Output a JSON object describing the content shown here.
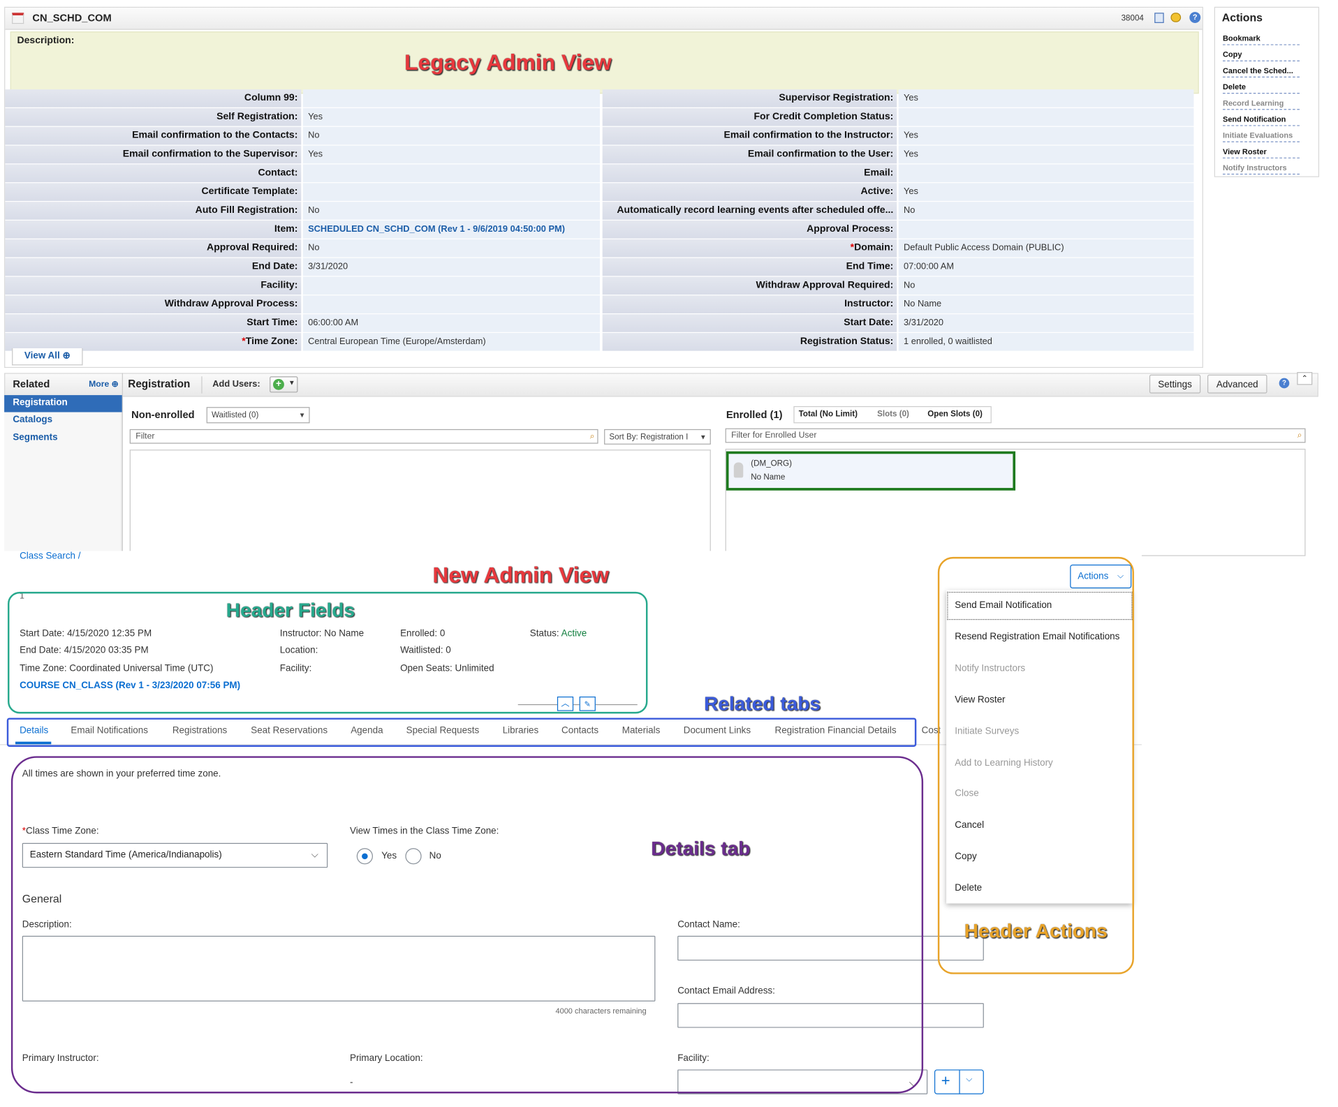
{
  "legacy": {
    "title": "CN_SCHD_COM",
    "record_id": "38004",
    "description_label": "Description:",
    "rows_left": [
      {
        "label": "Column 99:",
        "value": ""
      },
      {
        "label": "Self Registration:",
        "value": "Yes"
      },
      {
        "label": "Email confirmation to the Contacts:",
        "value": "No"
      },
      {
        "label": "Email confirmation to the Supervisor:",
        "value": "Yes"
      },
      {
        "label": "Contact:",
        "value": ""
      },
      {
        "label": "Certificate Template:",
        "value": ""
      },
      {
        "label": "Auto Fill Registration:",
        "value": "No"
      },
      {
        "label": "Item:",
        "value": "SCHEDULED CN_SCHD_COM (Rev 1 - 9/6/2019 04:50:00 PM)"
      },
      {
        "label": "Approval Required:",
        "value": "No"
      },
      {
        "label": "End Date:",
        "value": "3/31/2020"
      },
      {
        "label": "Facility:",
        "value": ""
      },
      {
        "label": "Withdraw Approval Process:",
        "value": ""
      },
      {
        "label": "Start Time:",
        "value": "06:00:00 AM"
      },
      {
        "label": "Time Zone:",
        "value": "Central European Time (Europe/Amsterdam)"
      }
    ],
    "rows_right": [
      {
        "label": "Supervisor Registration:",
        "value": "Yes"
      },
      {
        "label": "For Credit Completion Status:",
        "value": ""
      },
      {
        "label": "Email confirmation to the Instructor:",
        "value": "Yes"
      },
      {
        "label": "Email confirmation to the User:",
        "value": "Yes"
      },
      {
        "label": "Email:",
        "value": ""
      },
      {
        "label": "Active:",
        "value": "Yes"
      },
      {
        "label": "Automatically record learning events after scheduled offe...",
        "value": "No"
      },
      {
        "label": "Approval Process:",
        "value": ""
      },
      {
        "label": "Domain:",
        "value": "Default Public Access Domain (PUBLIC)"
      },
      {
        "label": "End Time:",
        "value": "07:00:00 AM"
      },
      {
        "label": "Withdraw Approval Required:",
        "value": "No"
      },
      {
        "label": "Instructor:",
        "value": "No Name"
      },
      {
        "label": "Start Date:",
        "value": "3/31/2020"
      },
      {
        "label": "Registration Status:",
        "value": "1 enrolled, 0 waitlisted"
      }
    ],
    "view_all": "View All",
    "actions": {
      "title": "Actions",
      "items": [
        "Bookmark",
        "Copy",
        "Cancel the Sched...",
        "Delete",
        "Record Learning",
        "Send Notification",
        "Initiate Evaluations",
        "View Roster",
        "Notify Instructors"
      ]
    },
    "related": {
      "title": "Related",
      "more": "More",
      "items": [
        "Registration",
        "Catalogs",
        "Segments"
      ],
      "section_title": "Registration",
      "add_users": "Add Users:",
      "settings": "Settings",
      "advanced": "Advanced",
      "non_enrolled": "Non-enrolled",
      "waitlisted_select": "Waitlisted (0)",
      "filter_placeholder": "Filter",
      "sort_by": "Sort By: Registration I",
      "enrolled": "Enrolled (1)",
      "total": "Total (No Limit)",
      "slots": "Slots (0)",
      "open_slots": "Open Slots (0)",
      "enrolled_filter_placeholder": "Filter for Enrolled User",
      "user_org": "(DM_ORG)",
      "user_name": "No Name"
    }
  },
  "new_view": {
    "breadcrumb": "Class Search /",
    "class_id": "1",
    "actions_button": "Actions",
    "header": {
      "start_date": "Start Date: 4/15/2020 12:35 PM",
      "end_date": "End Date: 4/15/2020 03:35 PM",
      "time_zone": "Time Zone: Coordinated Universal Time (UTC)",
      "course_link": "COURSE CN_CLASS (Rev 1 - 3/23/2020 07:56 PM)",
      "instructor": "Instructor: No Name",
      "location": "Location:",
      "facility": "Facility:",
      "enrolled": "Enrolled: 0",
      "waitlisted": "Waitlisted: 0",
      "open_seats": "Open Seats: Unlimited",
      "status_label": "Status:",
      "status_value": "Active"
    },
    "tabs": [
      "Details",
      "Email Notifications",
      "Registrations",
      "Seat Reservations",
      "Agenda",
      "Special Requests",
      "Libraries",
      "Contacts",
      "Materials",
      "Document Links",
      "Registration Financial Details",
      "Cost"
    ],
    "details": {
      "tz_note": "All times are shown in your preferred time zone.",
      "class_time_zone_label": "Class Time Zone:",
      "class_time_zone_value": "Eastern Standard Time (America/Indianapolis)",
      "view_times_label": "View Times in the Class Time Zone:",
      "yes": "Yes",
      "no": "No",
      "general": "General",
      "description_label": "Description:",
      "chars_remaining": "4000 characters remaining",
      "contact_name_label": "Contact Name:",
      "contact_email_label": "Contact Email Address:",
      "primary_instructor_label": "Primary Instructor:",
      "primary_location_label": "Primary Location:",
      "primary_location_value": "-",
      "facility_label": "Facility:"
    },
    "actions_menu": [
      "Send Email Notification",
      "Resend Registration Email Notifications",
      "Notify Instructors",
      "View Roster",
      "Initiate Surveys",
      "Add to Learning History",
      "Close",
      "Cancel",
      "Copy",
      "Delete"
    ]
  },
  "annotations": {
    "legacy": "Legacy Admin View",
    "new": "New Admin View",
    "header_fields": "Header Fields",
    "related_tabs": "Related tabs",
    "details_tab": "Details tab",
    "header_actions": "Header Actions"
  },
  "colors": {
    "legacy_anno": "#e8383d",
    "new_anno": "#e8383d",
    "header_fields": "#27a98d",
    "related_tabs": "#3b5bdb",
    "details_tab": "#6b2d8e",
    "header_actions": "#e8a329",
    "link_blue": "#1b5da8",
    "sap_blue": "#0a6ed1",
    "enrolled_box": "#1e7a1e"
  }
}
